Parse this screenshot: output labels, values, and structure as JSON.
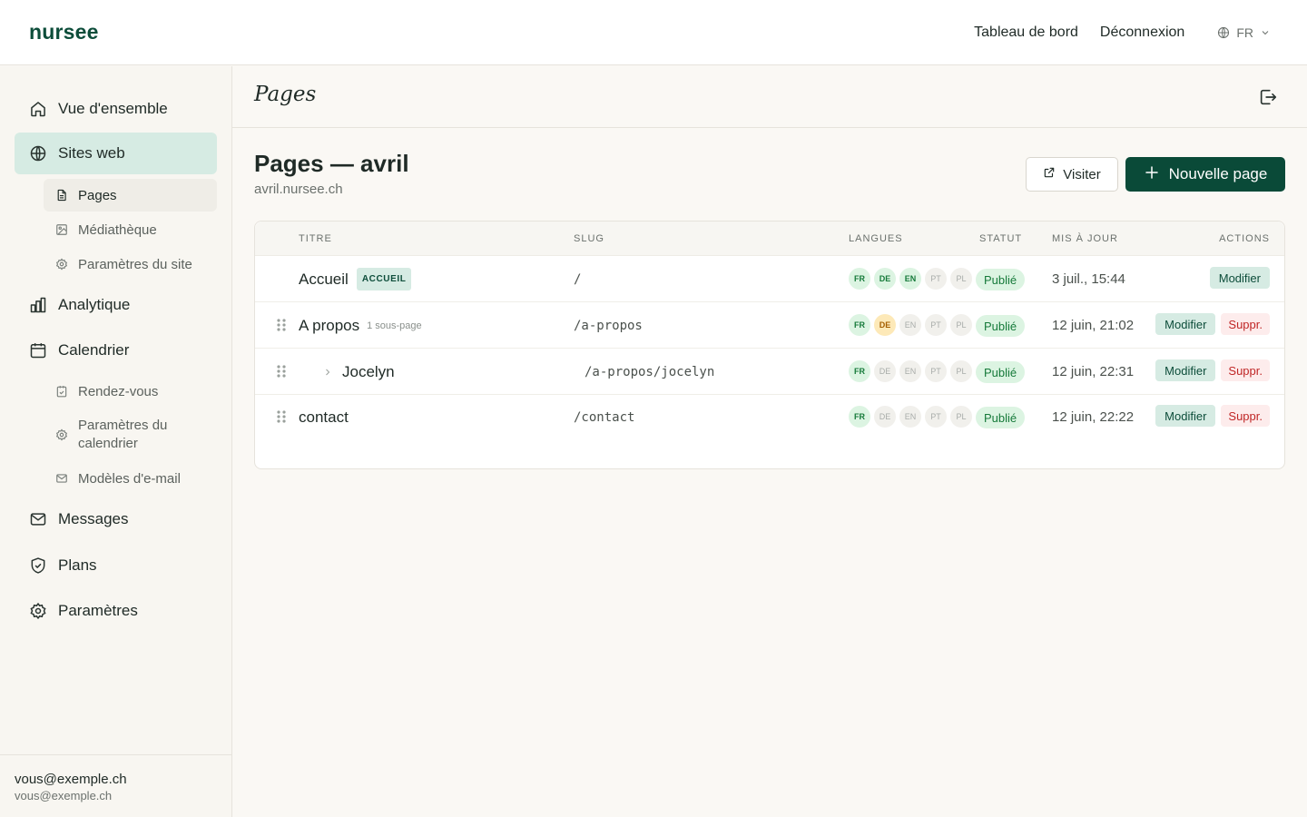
{
  "app": {
    "logo": "nursee"
  },
  "topnav": {
    "dashboard": "Tableau de bord",
    "logout": "Déconnexion",
    "language": "FR"
  },
  "sidebar": {
    "items": [
      {
        "label": "Vue d'ensemble",
        "icon": "home-icon"
      },
      {
        "label": "Sites web",
        "icon": "globe-icon",
        "active": true
      },
      {
        "label": "Analytique",
        "icon": "chart-icon"
      },
      {
        "label": "Calendrier",
        "icon": "calendar-icon"
      },
      {
        "label": "Messages",
        "icon": "mail-icon"
      },
      {
        "label": "Plans",
        "icon": "shield-icon"
      },
      {
        "label": "Paramètres",
        "icon": "gear-icon"
      }
    ],
    "sites_sub": [
      {
        "label": "Pages",
        "icon": "file-icon",
        "active": true
      },
      {
        "label": "Médiathèque",
        "icon": "image-icon"
      },
      {
        "label": "Paramètres du site",
        "icon": "gear-icon"
      }
    ],
    "calendar_sub": [
      {
        "label": "Rendez-vous",
        "icon": "calendar-check-icon"
      },
      {
        "label": "Paramètres du calendrier",
        "icon": "gear-icon"
      },
      {
        "label": "Modèles d'e-mail",
        "icon": "mail-icon"
      }
    ],
    "user": {
      "name": "vous@exemple.ch",
      "email": "vous@exemple.ch"
    }
  },
  "page_header": {
    "title": "Pages"
  },
  "main": {
    "title": "Pages — avril",
    "subtitle": "avril.nursee.ch",
    "visit_label": "Visiter",
    "new_page_label": "Nouvelle page"
  },
  "table": {
    "headers": {
      "title": "Titre",
      "slug": "Slug",
      "languages": "Langues",
      "status": "Statut",
      "updated": "Mis à jour",
      "actions": "Actions"
    },
    "rows": [
      {
        "title": "Accueil",
        "badge": "ACCUEIL",
        "slug": "/",
        "langs": [
          {
            "code": "FR",
            "state": "on"
          },
          {
            "code": "DE",
            "state": "on"
          },
          {
            "code": "EN",
            "state": "on"
          },
          {
            "code": "PT",
            "state": "off"
          },
          {
            "code": "PL",
            "state": "off"
          }
        ],
        "status": "Publié",
        "updated": "3 juil., 15:44",
        "edit": "Modifier"
      },
      {
        "title": "A propos",
        "subpages": "1 sous-page",
        "slug": "/a-propos",
        "langs": [
          {
            "code": "FR",
            "state": "on"
          },
          {
            "code": "DE",
            "state": "warn"
          },
          {
            "code": "EN",
            "state": "off"
          },
          {
            "code": "PT",
            "state": "off"
          },
          {
            "code": "PL",
            "state": "off"
          }
        ],
        "status": "Publié",
        "updated": "12 juin, 21:02",
        "edit": "Modifier",
        "delete": "Suppr."
      },
      {
        "title": "Jocelyn",
        "slug": "/a-propos/jocelyn",
        "langs": [
          {
            "code": "FR",
            "state": "on"
          },
          {
            "code": "DE",
            "state": "off"
          },
          {
            "code": "EN",
            "state": "off"
          },
          {
            "code": "PT",
            "state": "off"
          },
          {
            "code": "PL",
            "state": "off"
          }
        ],
        "status": "Publié",
        "updated": "12 juin, 22:31",
        "edit": "Modifier",
        "delete": "Suppr."
      },
      {
        "title": "contact",
        "slug": "/contact",
        "langs": [
          {
            "code": "FR",
            "state": "on"
          },
          {
            "code": "DE",
            "state": "off"
          },
          {
            "code": "EN",
            "state": "off"
          },
          {
            "code": "PT",
            "state": "off"
          },
          {
            "code": "PL",
            "state": "off"
          }
        ],
        "status": "Publié",
        "updated": "12 juin, 22:22",
        "edit": "Modifier",
        "delete": "Suppr."
      }
    ]
  }
}
